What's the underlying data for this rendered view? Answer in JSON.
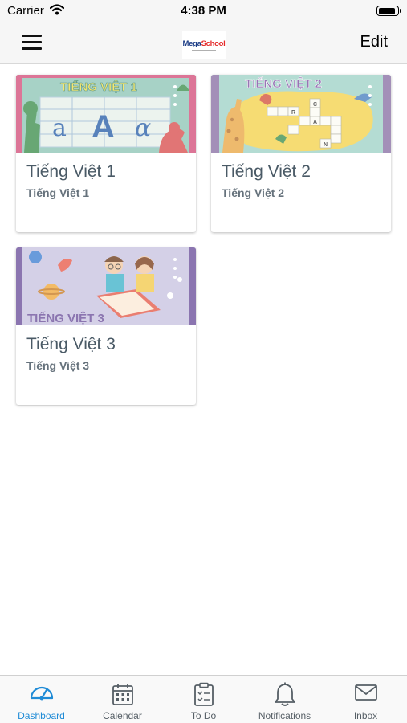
{
  "status_bar": {
    "carrier": "Carrier",
    "time": "4:38 PM",
    "battery_level": 0.9
  },
  "nav_bar": {
    "menu_icon": "hamburger-menu-icon",
    "logo": {
      "primary": "Mega",
      "accent": "School"
    },
    "edit_label": "Edit"
  },
  "courses": [
    {
      "title": "Tiếng Việt 1",
      "subtitle": "Tiếng Việt 1",
      "image_banner": "TIẾNG VIỆT 1",
      "image_letters": [
        "a",
        "A",
        "α"
      ],
      "image_bg": "#8fc6b6",
      "frame_color": "#d24f7a"
    },
    {
      "title": "Tiếng Việt 2",
      "subtitle": "Tiếng Việt 2",
      "image_banner": "TIẾNG VIỆT 2",
      "image_letters": [
        "R",
        "C",
        "A",
        "N"
      ],
      "image_bg": "#9fd3c7",
      "frame_color": "#8a70a5"
    },
    {
      "title": "Tiếng Việt 3",
      "subtitle": "Tiếng Việt 3",
      "image_banner": "TIẾNG VIỆT 3",
      "image_bg": "#c8c3e0",
      "frame_color": "#6b4f9a"
    }
  ],
  "tab_bar": {
    "active": "dashboard",
    "tabs": [
      {
        "key": "dashboard",
        "label": "Dashboard",
        "icon": "dashboard-gauge-icon"
      },
      {
        "key": "calendar",
        "label": "Calendar",
        "icon": "calendar-icon"
      },
      {
        "key": "todo",
        "label": "To Do",
        "icon": "clipboard-checklist-icon"
      },
      {
        "key": "notifications",
        "label": "Notifications",
        "icon": "bell-icon"
      },
      {
        "key": "inbox",
        "label": "Inbox",
        "icon": "envelope-icon"
      }
    ]
  },
  "colors": {
    "accent": "#1f8bd6",
    "tab_inactive": "#565f66",
    "card_title": "#4a5a66"
  }
}
